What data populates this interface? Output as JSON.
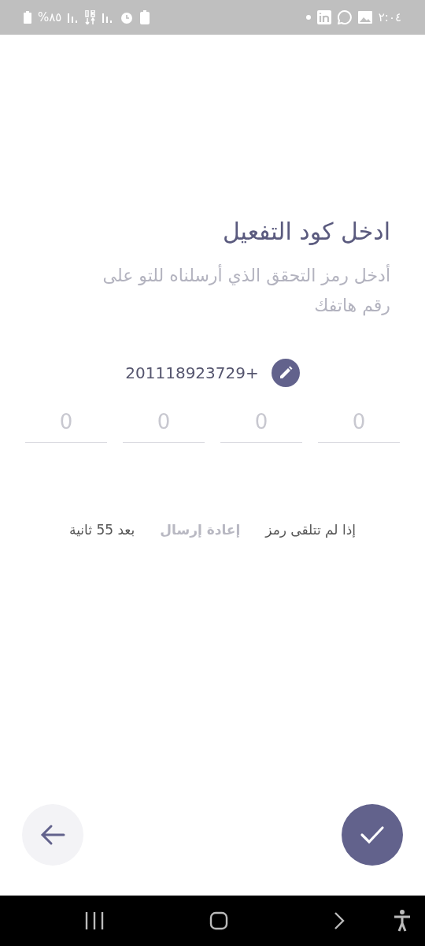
{
  "status_bar": {
    "time": "٢:٠٤",
    "battery": "%٨٥"
  },
  "title": "ادخل كود التفعيل",
  "subtitle": "أدخل رمز التحقق الذي أرسلناه للتو على رقم هاتفك",
  "phone": {
    "number": "201118923729+"
  },
  "code_fields": [
    {
      "placeholder": "0"
    },
    {
      "placeholder": "0"
    },
    {
      "placeholder": "0"
    },
    {
      "placeholder": "0"
    }
  ],
  "resend": {
    "prompt": "إذا لم تتلقى رمز",
    "action": "إعادة إرسال",
    "disabled": true,
    "countdown": "بعد 55 ثانية"
  }
}
